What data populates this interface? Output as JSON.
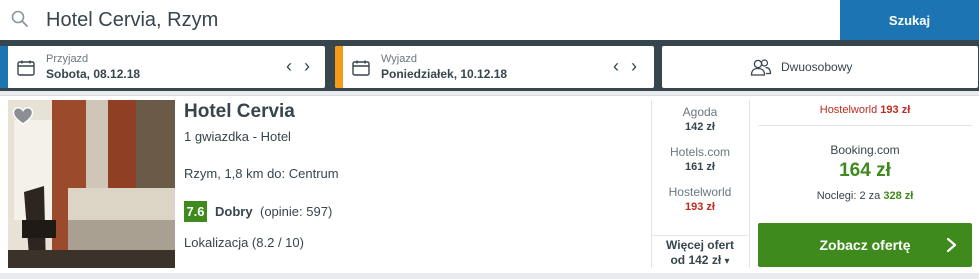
{
  "search": {
    "query": "Hotel Cervia, Rzym",
    "button_label": "Szukaj"
  },
  "checkin": {
    "label": "Przyjazd",
    "value": "Sobota, 08.12.18",
    "accent_color": "#1c74b3"
  },
  "checkout": {
    "label": "Wyjazd",
    "value": "Poniedziałek, 10.12.18",
    "accent_color": "#f59b1c"
  },
  "room": {
    "label": "Dwuosobowy"
  },
  "hotel": {
    "name": "Hotel Cervia",
    "stars_text": "1 gwiazdka -  Hotel",
    "location_text": "Rzym, 1,8 km do: Centrum",
    "rating": "7.6",
    "rating_label": "Dobry",
    "rating_count": "(opinie: 597)",
    "location_score": "Lokalizacja (8.2 / 10)"
  },
  "alternative_deals": [
    {
      "provider": "Agoda",
      "price": "142 zł"
    },
    {
      "provider": "Hotels.com",
      "price": "161 zł"
    },
    {
      "provider": "Hostelworld",
      "price": "193 zł"
    }
  ],
  "more_offers": {
    "line1": "Więcej ofert",
    "line2": "od 142 zł"
  },
  "top_deal": {
    "provider": "Hostelworld",
    "price": "193 zł"
  },
  "best_deal": {
    "provider": "Booking.com",
    "price": "164 zł",
    "nights_text": "Noclegi: 2 za",
    "nights_total": "328 zł",
    "button_label": "Zobacz ofertę"
  },
  "colors": {
    "brand_blue": "#1c74b3",
    "deal_green": "#3f8a1c",
    "price_red": "#c02b1e",
    "dark_strip": "#37454d"
  },
  "icons": {
    "search": "search-icon",
    "calendar": "calendar-icon",
    "guests": "guests-icon",
    "favorite": "heart-icon",
    "prev": "chevron-left-icon",
    "next": "chevron-right-icon"
  }
}
